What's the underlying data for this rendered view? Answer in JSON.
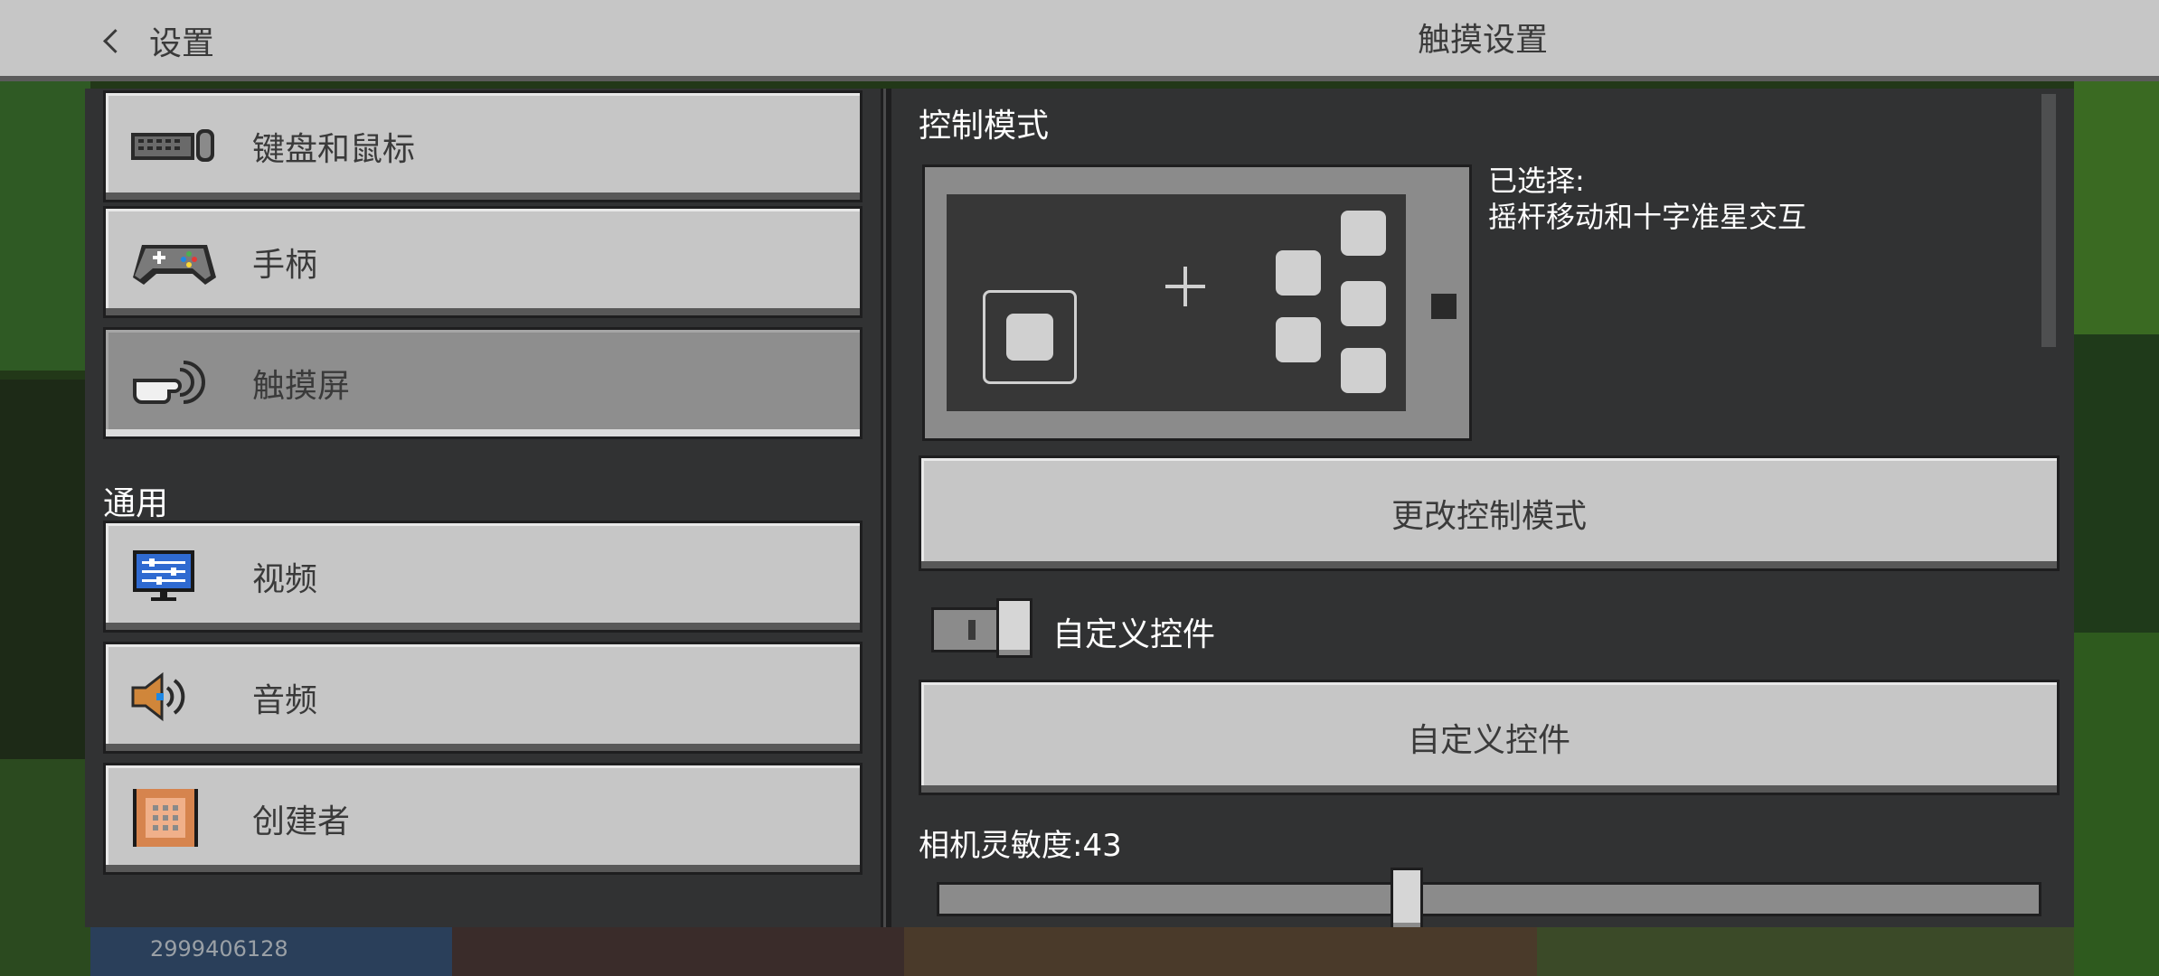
{
  "header": {
    "back_label": "设置",
    "title": "触摸设置"
  },
  "sidebar": {
    "items": [
      {
        "label": "键盘和鼠标",
        "icon": "keyboard-mouse-icon"
      },
      {
        "label": "手柄",
        "icon": "gamepad-icon"
      },
      {
        "label": "触摸屏",
        "icon": "touch-hand-icon",
        "selected": true
      }
    ],
    "general_label": "通用",
    "general_items": [
      {
        "label": "视频",
        "icon": "monitor-icon"
      },
      {
        "label": "音频",
        "icon": "speaker-icon"
      },
      {
        "label": "创建者",
        "icon": "command-block-icon"
      }
    ]
  },
  "main": {
    "control_mode_title": "控制模式",
    "selected_prefix": "已选择:",
    "selected_value": "摇杆移动和十字准星交互",
    "change_mode_button": "更改控制模式",
    "custom_controls_toggle_label": "自定义控件",
    "custom_controls_toggle_on": false,
    "custom_controls_button": "自定义控件",
    "camera_sensitivity_label": "相机灵敏度:43",
    "camera_sensitivity_value": 43
  },
  "footer": {
    "id_text": "2999406128"
  },
  "colors": {
    "button_face": "#c6c6c6",
    "panel": "#313233",
    "selected_button": "#8e8e8e"
  }
}
